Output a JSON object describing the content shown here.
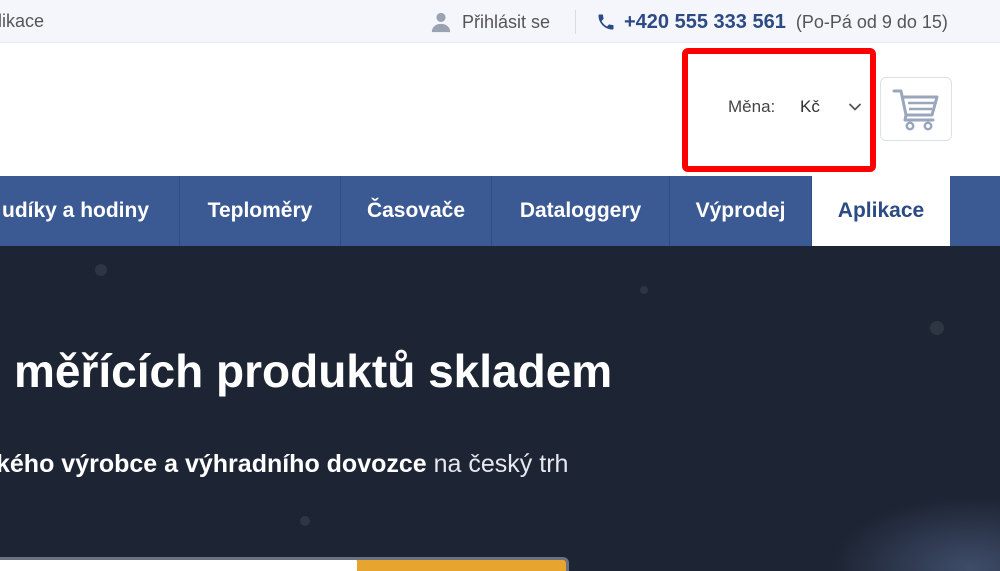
{
  "topbar": {
    "left_link_partial": "likace",
    "login_label": "Přihlásit se",
    "phone_number": "+420 555 333 561",
    "phone_hours": "(Po-Pá od 9 do 15)"
  },
  "header": {
    "currency_label": "Měna:",
    "currency_value": "Kč"
  },
  "nav": {
    "items": [
      {
        "label": "udíky a hodiny"
      },
      {
        "label": "Teploměry"
      },
      {
        "label": "Časovače"
      },
      {
        "label": "Dataloggery"
      },
      {
        "label": "Výprodej"
      },
      {
        "label": "Aplikace"
      }
    ]
  },
  "hero": {
    "title_partial": "měřících produktů skladem",
    "subtitle_bold": "kého výrobce a výhradního dovozce",
    "subtitle_rest": " na český trh"
  },
  "colors": {
    "nav_bg": "#3b5a94",
    "brand_blue": "#2c4a84",
    "hero_bg": "#1d2433",
    "highlight_red": "#ff0000",
    "search_button": "#e7a42f"
  }
}
